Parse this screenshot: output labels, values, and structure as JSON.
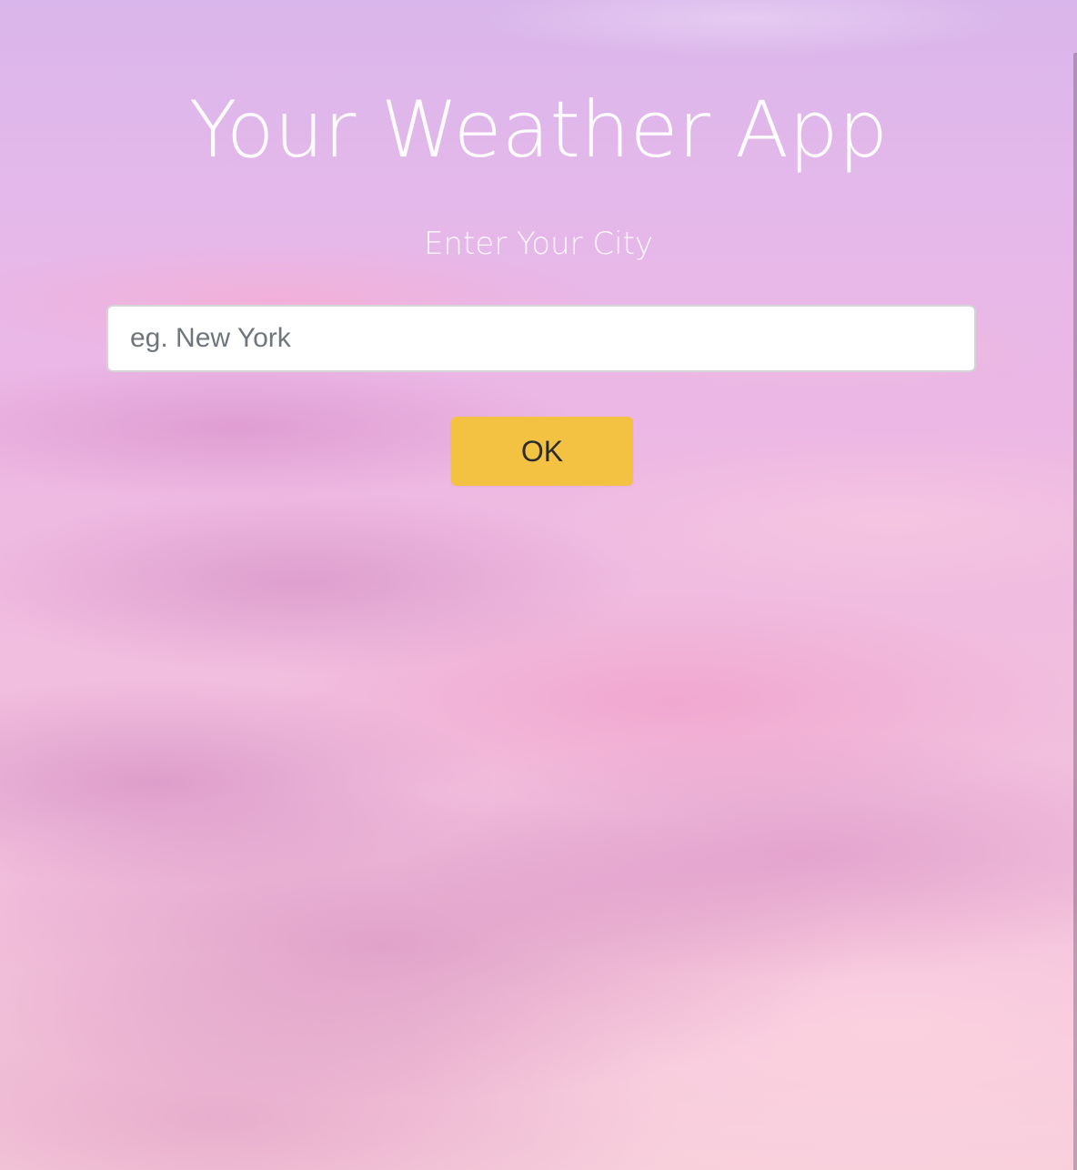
{
  "app": {
    "title": "Your Weather App",
    "subtitle": "Enter Your City"
  },
  "search": {
    "value": "",
    "placeholder": "eg. New York"
  },
  "actions": {
    "ok_label": "OK"
  },
  "colors": {
    "button_background": "#f4c242",
    "title_text": "#ffffff",
    "input_background": "#ffffff"
  }
}
